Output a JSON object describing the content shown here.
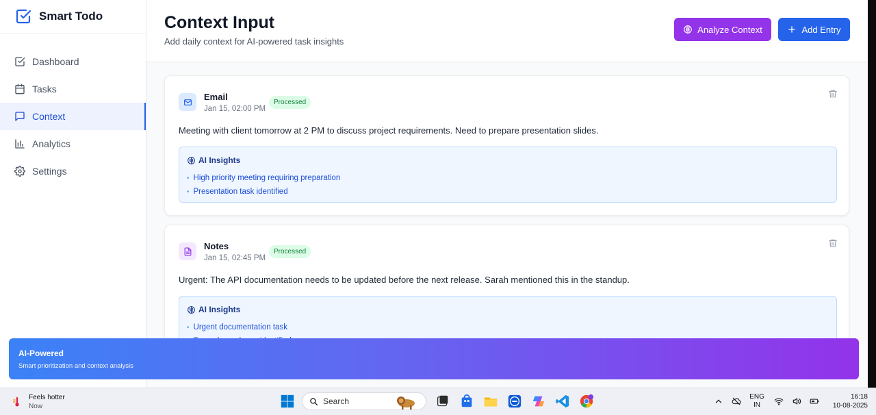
{
  "app": {
    "name": "Smart Todo"
  },
  "sidebar": {
    "items": [
      {
        "label": "Dashboard",
        "icon": "checkbox-icon",
        "active": false
      },
      {
        "label": "Tasks",
        "icon": "calendar-icon",
        "active": false
      },
      {
        "label": "Context",
        "icon": "chat-icon",
        "active": true
      },
      {
        "label": "Analytics",
        "icon": "bar-chart-icon",
        "active": false
      },
      {
        "label": "Settings",
        "icon": "gear-icon",
        "active": false
      }
    ]
  },
  "header": {
    "title": "Context Input",
    "subtitle": "Add daily context for AI-powered task insights",
    "analyze_label": "Analyze Context",
    "add_label": "Add Entry"
  },
  "entries": [
    {
      "source": "Email",
      "time": "Jan 15, 02:00 PM",
      "status": "Processed",
      "content": "Meeting with client tomorrow at 2 PM to discuss project requirements. Need to prepare presentation slides.",
      "insights_title": "AI Insights",
      "insights": [
        "High priority meeting requiring preparation",
        "Presentation task identified"
      ]
    },
    {
      "source": "Notes",
      "time": "Jan 15, 02:45 PM",
      "status": "Processed",
      "content": "Urgent: The API documentation needs to be updated before the next release. Sarah mentioned this in the standup.",
      "insights_title": "AI Insights",
      "insights": [
        "Urgent documentation task",
        "Team dependency identified"
      ]
    }
  ],
  "banner": {
    "title": "AI-Powered",
    "subtitle": "Smart prioritization and context analysis"
  },
  "taskbar": {
    "weather_title": "Feels hotter",
    "weather_sub": "Now",
    "search_placeholder": "Search",
    "lang_top": "ENG",
    "lang_bottom": "IN",
    "time": "16:18",
    "date": "10-08-2025"
  },
  "colors": {
    "primary": "#2563eb",
    "purple": "#9333ea",
    "success_bg": "#dcfce7",
    "success_text": "#15803d"
  }
}
